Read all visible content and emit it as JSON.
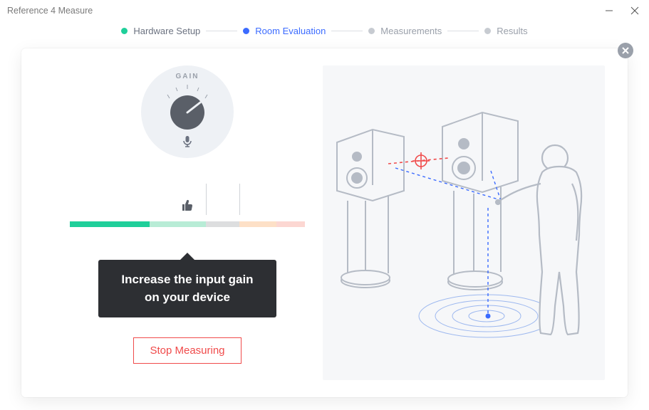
{
  "window": {
    "title": "Reference 4 Measure"
  },
  "stepper": {
    "steps": [
      {
        "label": "Hardware Setup",
        "state": "done"
      },
      {
        "label": "Room Evaluation",
        "state": "active"
      },
      {
        "label": "Measurements",
        "state": "idle"
      },
      {
        "label": "Results",
        "state": "idle"
      }
    ]
  },
  "gain": {
    "label": "GAIN"
  },
  "tooltip": {
    "line1": "Increase the input gain",
    "line2": "on your device"
  },
  "actions": {
    "stop": "Stop Measuring"
  },
  "colors": {
    "accent_blue": "#3b6bff",
    "accent_green": "#1fcf9a",
    "danger": "#f04b4b",
    "tooltip_bg": "#2d2f33"
  }
}
